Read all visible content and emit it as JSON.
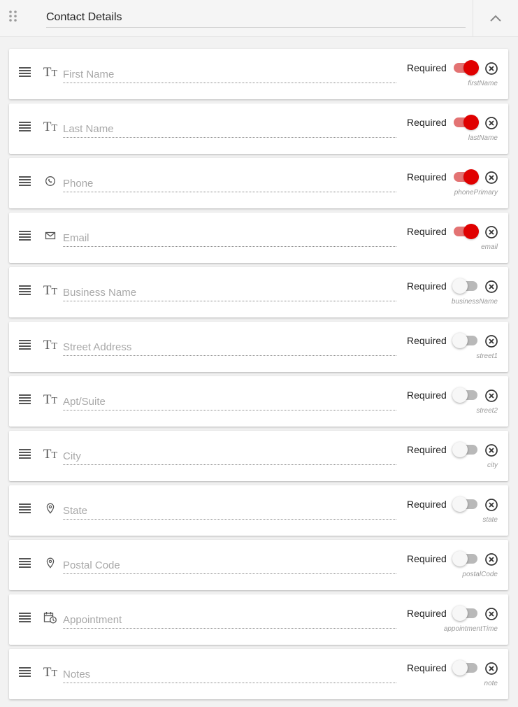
{
  "header": {
    "title": "Contact Details"
  },
  "required_label": "Required",
  "colors": {
    "accent": "#e00000",
    "accent_track": "#e37373",
    "off_track": "#b9b9b9"
  },
  "fields": [
    {
      "placeholder": "First Name",
      "field_name": "firstName",
      "icon": "text-type-icon",
      "required": true
    },
    {
      "placeholder": "Last Name",
      "field_name": "lastName",
      "icon": "text-type-icon",
      "required": true
    },
    {
      "placeholder": "Phone",
      "field_name": "phonePrimary",
      "icon": "phone-icon",
      "required": true
    },
    {
      "placeholder": "Email",
      "field_name": "email",
      "icon": "envelope-icon",
      "required": true
    },
    {
      "placeholder": "Business Name",
      "field_name": "businessName",
      "icon": "text-type-icon",
      "required": false
    },
    {
      "placeholder": "Street Address",
      "field_name": "street1",
      "icon": "text-type-icon",
      "required": false
    },
    {
      "placeholder": "Apt/Suite",
      "field_name": "street2",
      "icon": "text-type-icon",
      "required": false
    },
    {
      "placeholder": "City",
      "field_name": "city",
      "icon": "text-type-icon",
      "required": false
    },
    {
      "placeholder": "State",
      "field_name": "state",
      "icon": "map-pin-icon",
      "required": false
    },
    {
      "placeholder": "Postal Code",
      "field_name": "postalCode",
      "icon": "map-pin-icon",
      "required": false
    },
    {
      "placeholder": "Appointment",
      "field_name": "appointmentTime",
      "icon": "calendar-clock-icon",
      "required": false
    },
    {
      "placeholder": "Notes",
      "field_name": "note",
      "icon": "text-type-icon",
      "required": false
    }
  ]
}
